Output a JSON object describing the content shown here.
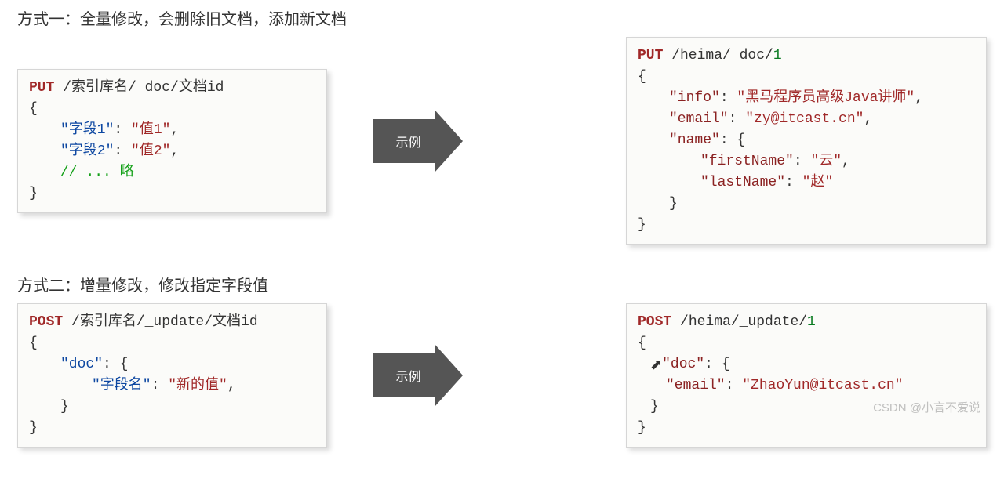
{
  "section1": {
    "title": "方式一：全量修改，会删除旧文档，添加新文档",
    "template": {
      "method": "PUT",
      "path": " /索引库名/_doc/文档id",
      "brace_open": "{",
      "line1_key": "\"字段1\"",
      "line1_val": "\"值1\"",
      "line2_key": "\"字段2\"",
      "line2_val": "\"值2\"",
      "comment": "// ... 略",
      "brace_close": "}"
    },
    "example": {
      "method": "PUT",
      "path": " /heima/_doc/",
      "id": "1",
      "info_k": "\"info\"",
      "info_v": "\"黑马程序员高级Java讲师\"",
      "email_k": "\"email\"",
      "email_v": "\"zy@itcast.cn\"",
      "name_k": "\"name\"",
      "fn_k": "\"firstName\"",
      "fn_v": "\"云\"",
      "ln_k": "\"lastName\"",
      "ln_v": "\"赵\""
    }
  },
  "arrow_label": "示例",
  "section2": {
    "title": "方式二：增量修改，修改指定字段值",
    "template": {
      "method": "POST",
      "path": " /索引库名/_update/文档id",
      "doc_k": "\"doc\"",
      "field_k": "\"字段名\"",
      "field_v": "\"新的值\""
    },
    "example": {
      "method": "POST",
      "path": " /heima/_update/",
      "id": "1",
      "doc_k": "\"doc\"",
      "email_k": "\"email\"",
      "email_v": "\"ZhaoYun@itcast.cn\""
    }
  },
  "watermark": "CSDN @小言不爱说"
}
